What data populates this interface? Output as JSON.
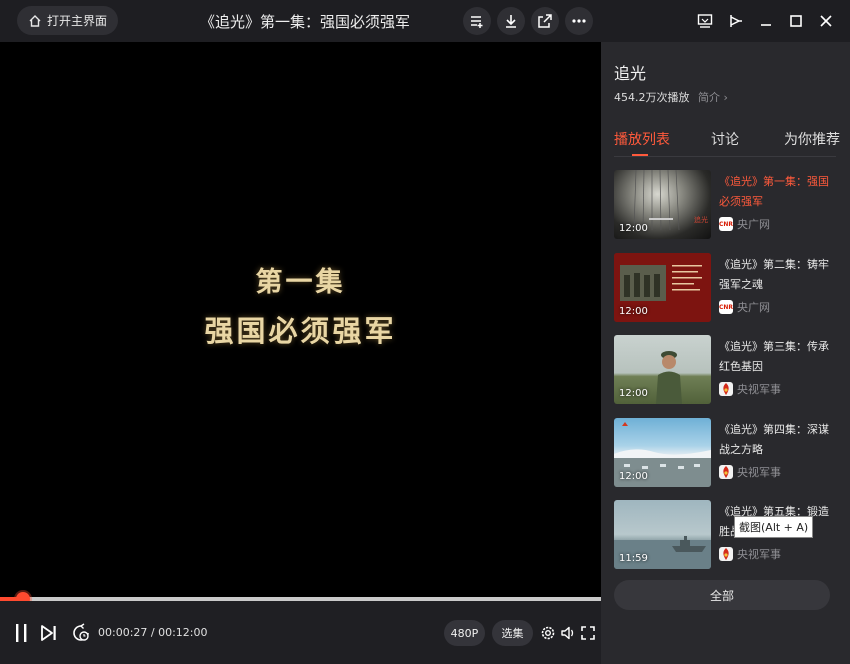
{
  "header": {
    "home_label": "打开主界面",
    "title": "《追光》第一集：强国必须强军",
    "icons": [
      "playlist-add-icon",
      "download-icon",
      "share-icon",
      "more-icon",
      "screen-cast-icon",
      "pin-icon",
      "minimize-icon",
      "maximize-icon",
      "close-icon"
    ]
  },
  "video": {
    "line1": "第一集",
    "line2": "强国必须强军",
    "progress": 0.0375
  },
  "controls": {
    "time": "00:00:27 / 00:12:00",
    "quality": "480P",
    "episodes": "选集"
  },
  "sidebar": {
    "title": "追光",
    "plays": "454.2万次播放",
    "intro": "简介",
    "tabs": [
      "播放列表",
      "讨论",
      "为你推荐"
    ],
    "episodes": [
      {
        "title": "《追光》第一集：强国必须强军",
        "duration": "12:00",
        "source": "央广网",
        "logo": "CNR",
        "active": true
      },
      {
        "title": "《追光》第二集：铸牢强军之魂",
        "duration": "12:00",
        "source": "央广网",
        "logo": "CNR",
        "active": false
      },
      {
        "title": "《追光》第三集：传承红色基因",
        "duration": "12:00",
        "source": "央视军事",
        "logo": "",
        "active": false
      },
      {
        "title": "《追光》第四集：深谋战之方略",
        "duration": "12:00",
        "source": "央视军事",
        "logo": "",
        "active": false
      },
      {
        "title": "《追光》第五集：锻造胜战",
        "duration": "11:59",
        "source": "央视军事",
        "logo": "",
        "active": false
      }
    ],
    "all_label": "全部"
  },
  "tooltip": "截图(Alt + A)",
  "colors": {
    "accent": "#ff5a3c",
    "progress": "#ff4a2f"
  }
}
